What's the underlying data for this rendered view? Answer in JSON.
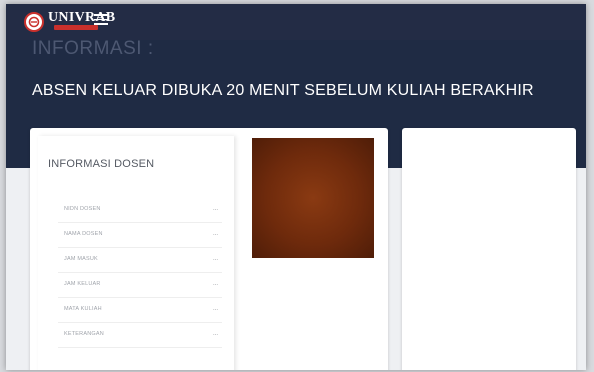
{
  "header": {
    "logo_text": "UNIVRAB",
    "menu_icon": "hamburger-menu-icon",
    "logo_icon": "university-logo-icon"
  },
  "hero": {
    "title": "INFORMASI :",
    "announcement": "ABSEN KELUAR DIBUKA 20 MENIT SEBELUM KULIAH BERAKHIR"
  },
  "dosen_panel": {
    "title": "INFORMASI DOSEN",
    "rows": [
      {
        "label": "NIDN DOSEN",
        "value": "..."
      },
      {
        "label": "NAMA DOSEN",
        "value": "..."
      },
      {
        "label": "JAM MASUK",
        "value": "..."
      },
      {
        "label": "JAM KELUAR",
        "value": "..."
      },
      {
        "label": "MATA KULIAH",
        "value": "..."
      },
      {
        "label": "KETERANGAN",
        "value": "..."
      }
    ]
  },
  "colors": {
    "topbar": "#232c45",
    "hero": "#1f2b44",
    "logo_red": "#c9302c",
    "photo": "#6e2a0c"
  }
}
